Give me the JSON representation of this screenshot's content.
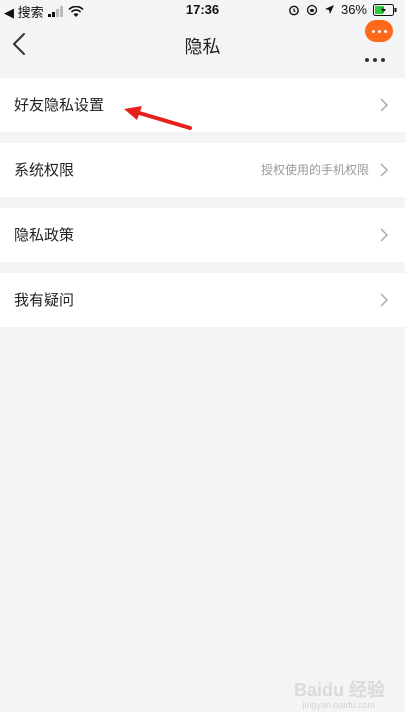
{
  "status_bar": {
    "back_app": "◀ 搜索",
    "time": "17:36",
    "battery": "36%"
  },
  "nav": {
    "title": "隐私"
  },
  "rows": [
    {
      "label": "好友隐私设置",
      "value": ""
    },
    {
      "label": "系统权限",
      "value": "授权使用的手机权限"
    },
    {
      "label": "隐私政策",
      "value": ""
    },
    {
      "label": "我有疑问",
      "value": ""
    }
  ],
  "watermark": {
    "text": "Baidu 经验",
    "sub": "jingyan.baidu.com"
  },
  "colors": {
    "background": "#f3f4f6",
    "row_bg": "#ffffff",
    "accent_orange": "#ff6a1a",
    "annotation_red": "#e8201a"
  }
}
